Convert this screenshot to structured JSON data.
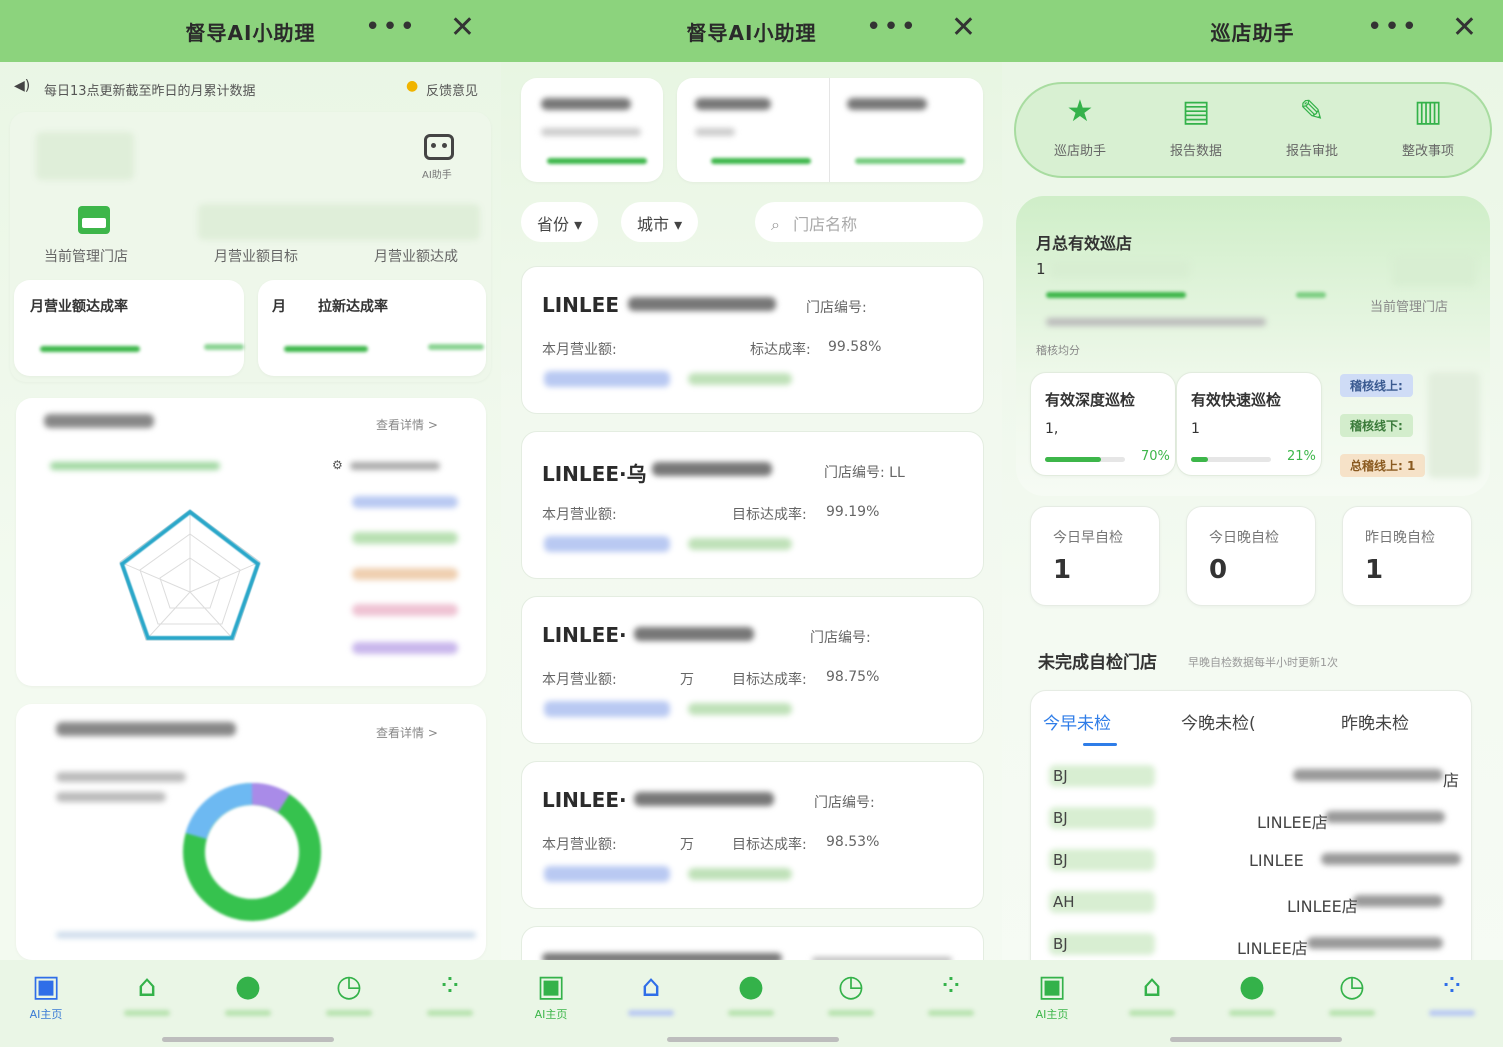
{
  "panel1": {
    "title": "督导AI小助理",
    "notice": "每日13点更新截至昨日的月累计数据",
    "feedback": "反馈意见",
    "robot_caption": "AI助手",
    "stats": {
      "store_label": "当前管理门店",
      "target_label": "月营业额目标",
      "achieved_label": "月营业额达成"
    },
    "rate_cards": {
      "left": "月营业额达成率",
      "right_a": "月",
      "right_b": "拉新达成率"
    },
    "radar_link": "查看详情 >",
    "donut_link": "查看详情 >",
    "nav_active_caption": "AI主页"
  },
  "panel2": {
    "title": "督导AI小助理",
    "filters": {
      "province": "省份 ▾",
      "city": "城市 ▾",
      "search_placeholder": "门店名称"
    },
    "stores": [
      {
        "name": "LINLEE",
        "code_label": "门店编号:",
        "sales_label": "本月营业额:",
        "sales_unit": "",
        "rate_label": "标达成率:",
        "rate": "99.58%"
      },
      {
        "name": "LINLEE·乌",
        "code_label": "门店编号: LL",
        "sales_label": "本月营业额:",
        "sales_unit": "",
        "rate_label": "目标达成率:",
        "rate": "99.19%"
      },
      {
        "name": "LINLEE·",
        "code_label": "门店编号:",
        "sales_label": "本月营业额:",
        "sales_unit": "万",
        "rate_label": "目标达成率:",
        "rate": "98.75%"
      },
      {
        "name": "LINLEE·",
        "code_label": "门店编号:",
        "sales_label": "本月营业额:",
        "sales_unit": "万",
        "rate_label": "目标达成率:",
        "rate": "98.53%"
      }
    ],
    "nav_active_caption": "AI主页"
  },
  "panel3": {
    "title": "巡店助手",
    "quick": [
      {
        "label": "巡店助手",
        "icon": "star-icon"
      },
      {
        "label": "报告数据",
        "icon": "clipboard-icon"
      },
      {
        "label": "报告审批",
        "icon": "approve-icon"
      },
      {
        "label": "整改事项",
        "icon": "factory-icon"
      }
    ],
    "monthly": {
      "title": "月总有效巡店",
      "value": "1",
      "store_label": "当前管理门店",
      "avg_label": "稽核均分"
    },
    "deep": {
      "label": "有效深度巡检",
      "value": "1,",
      "pct": "70%",
      "fill": 0.7
    },
    "quick_insp": {
      "label": "有效快速巡检",
      "value": "1",
      "pct": "21%",
      "fill": 0.21
    },
    "tags": [
      "稽核线上:",
      "稽核线下:",
      "总稽线上: 1"
    ],
    "checks": [
      {
        "label": "今日早自检",
        "value": "1"
      },
      {
        "label": "今日晚自检",
        "value": "0"
      },
      {
        "label": "昨日晚自检",
        "value": "1"
      }
    ],
    "incomplete": {
      "title": "未完成自检门店",
      "note": "早晚自检数据每半小时更新1次"
    },
    "tabs": [
      "今早未检",
      "今晚未检(",
      "昨晚未检"
    ],
    "rows": [
      {
        "code": "BJ",
        "name": "店"
      },
      {
        "code": "BJ",
        "name": "LINLEE店"
      },
      {
        "code": "BJ",
        "name": "LINLEE"
      },
      {
        "code": "AH",
        "name": "LINLEE店"
      },
      {
        "code": "BJ",
        "name": "LINLEE店"
      }
    ],
    "nav_active_caption": "AI主页"
  },
  "colors": {
    "accent_green": "#3db64a",
    "title_bar": "#8cd37d",
    "active_blue": "#2f6ee8"
  }
}
